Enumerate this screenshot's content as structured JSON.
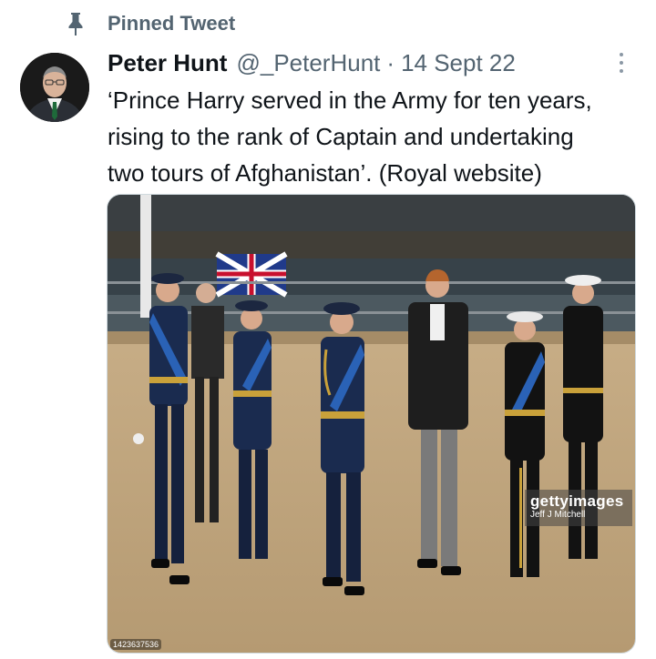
{
  "pinned": {
    "label": "Pinned Tweet",
    "icon": "pin-icon"
  },
  "author": {
    "name": "Peter Hunt",
    "handle": "@_PeterHunt",
    "separator": "·",
    "date": "14 Sept 22"
  },
  "tweet": {
    "lines": [
      "‘Prince Harry served in the Army for ten years,",
      "rising to the rank of Captain and undertaking",
      "two tours of Afghanistan’. (Royal website)"
    ]
  },
  "media": {
    "watermark_brand": "gettyimages",
    "watermark_credit": "Jeff J Mitchell",
    "image_id": "1423637536"
  },
  "colors": {
    "text": "#0f1419",
    "secondary": "#536471",
    "border": "#cfd9de",
    "raf_blue": "#1a2b4f",
    "sash_blue": "#2a62b6",
    "gold": "#c9a13a"
  }
}
